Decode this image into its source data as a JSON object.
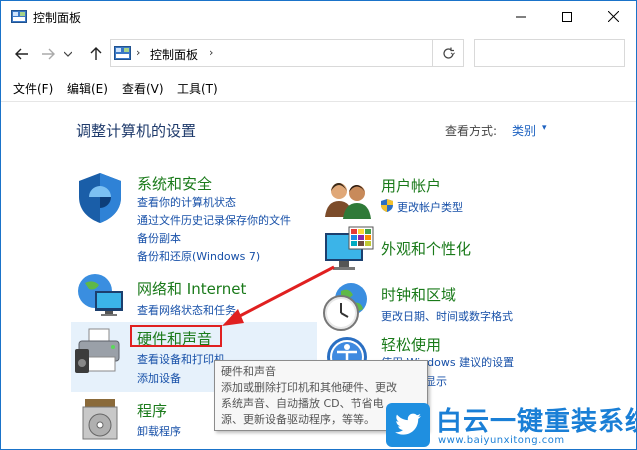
{
  "window": {
    "title": "控制面板",
    "minimize_icon": "minimize-icon",
    "maximize_icon": "maximize-icon",
    "close_icon": "close-icon"
  },
  "navigation": {
    "back_icon": "arrow-left-icon",
    "forward_icon": "arrow-right-icon",
    "recent_icon": "chevron-down-icon",
    "up_icon": "arrow-up-icon",
    "address_separator": "›",
    "address_path": "控制面板",
    "address_separator2": "›",
    "address_dropdown": "⌄",
    "refresh_icon": "refresh-icon",
    "search_placeholder": ""
  },
  "menu": [
    "文件(F)",
    "编辑(E)",
    "查看(V)",
    "工具(T)"
  ],
  "content": {
    "heading": "调整计算机的设置",
    "view_by_label": "查看方式:",
    "view_by_value": "类别",
    "view_by_arrow": "▾"
  },
  "categories": {
    "system": {
      "title": "系统和安全",
      "links": [
        "查看你的计算机状态",
        "通过文件历史记录保存你的文件",
        "备份副本",
        "备份和还原(Windows 7)"
      ]
    },
    "network": {
      "title": "网络和 Internet",
      "links": [
        "查看网络状态和任务"
      ]
    },
    "hardware": {
      "title": "硬件和声音",
      "links": [
        "查看设备和打印机",
        "添加设备"
      ]
    },
    "programs": {
      "title": "程序",
      "links": [
        "卸载程序"
      ]
    },
    "users": {
      "title": "用户帐户",
      "links": [
        "更改帐户类型"
      ]
    },
    "appearance": {
      "title": "外观和个性化",
      "links": []
    },
    "clock": {
      "title": "时钟和区域",
      "links": [
        "更改日期、时间或数字格式"
      ]
    },
    "ease": {
      "title": "轻松使用",
      "links": [
        "使用 Windows 建议的设置",
        "优化视觉显示"
      ]
    }
  },
  "tooltip": {
    "lines": [
      "硬件和声音",
      "添加或删除打印机和其他硬件、更改",
      "系统声音、自动播放 CD、节省电",
      "源、更新设备驱动程序，等等。"
    ]
  },
  "watermark": {
    "title": "白云一键重装系统",
    "url": "www.baiyunxitong.com"
  },
  "colors": {
    "category_title": "#1a7a1a",
    "link": "#1750a8",
    "heading": "#1e3a6b",
    "annotation": "#e02020",
    "watermark": "#1a7fd6"
  }
}
